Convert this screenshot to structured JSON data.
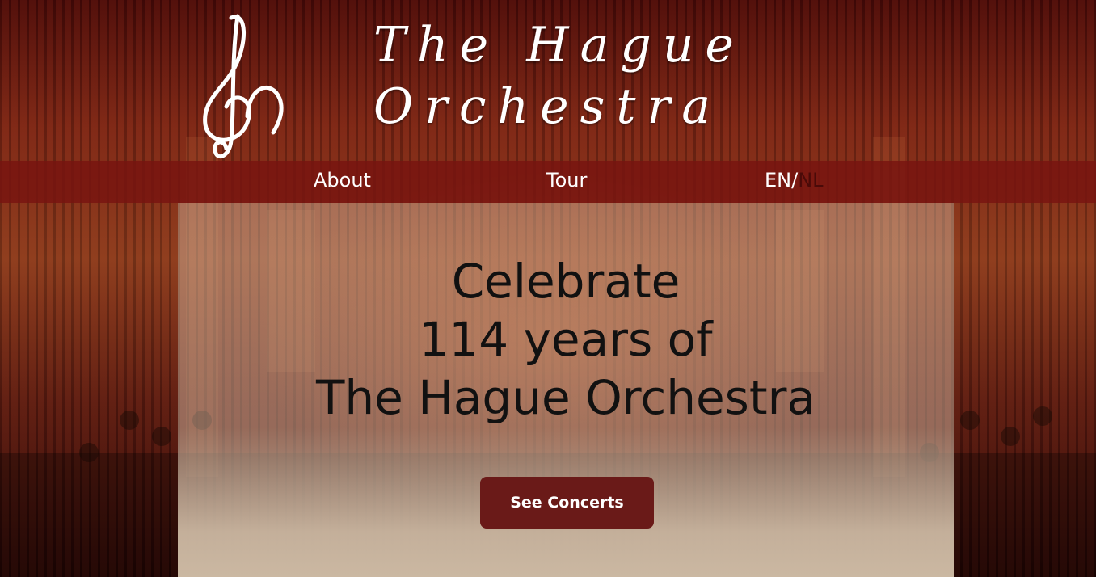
{
  "brand": {
    "name_line1": "The Hague",
    "name_line2": "Orchestra"
  },
  "nav": {
    "about": "About",
    "tour": "Tour",
    "lang_en": "EN/",
    "lang_nl": "NL"
  },
  "hero": {
    "line1": "Celebrate",
    "line2": "114 years of",
    "line3": "The Hague Orchestra",
    "cta_label": "See Concerts"
  },
  "colors": {
    "nav_bar": "#781410",
    "cta": "#6a1a18",
    "hero_panel": "#d6bea8",
    "active_lang": "#4a0a08"
  },
  "icons": {
    "logo": "treble-clef-logo-icon"
  }
}
